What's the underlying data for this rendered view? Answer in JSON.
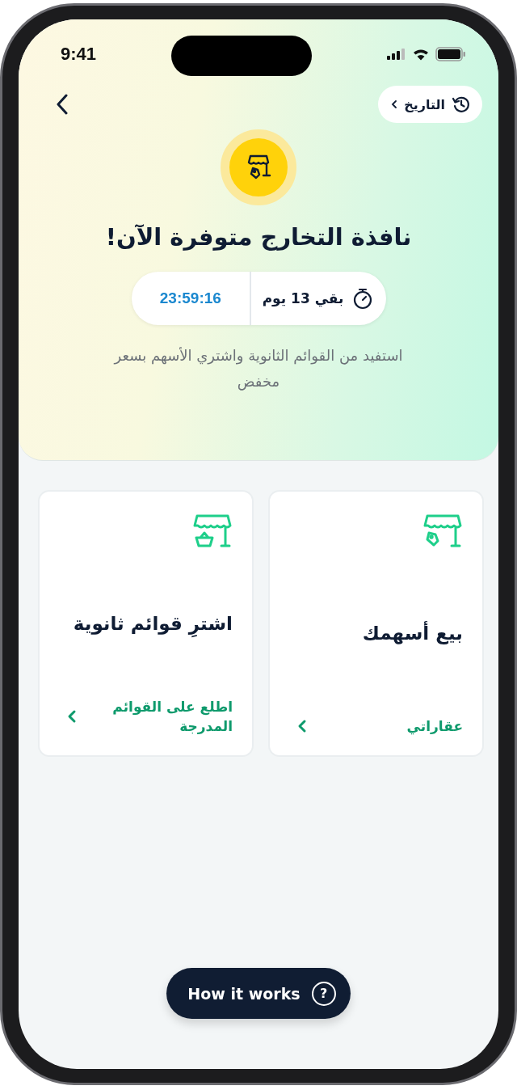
{
  "status_bar": {
    "time": "9:41"
  },
  "nav": {
    "history_label": "التاريخ"
  },
  "title": "نافذة التخارج متوفرة الآن!",
  "timer": {
    "remaining": "بقي 13 يوم",
    "clock": "23:59:16"
  },
  "description": "استفيد من القوائم الثانوية واشتري الأسهم بسعر مخفض",
  "cards": [
    {
      "title": "بيع أسهمك",
      "link": "عقاراتي"
    },
    {
      "title": "اشترِ قوائم ثانوية",
      "link": "اطلع على القوائم المدرجة"
    }
  ],
  "help_button": {
    "label": "How it works",
    "icon": "?"
  }
}
